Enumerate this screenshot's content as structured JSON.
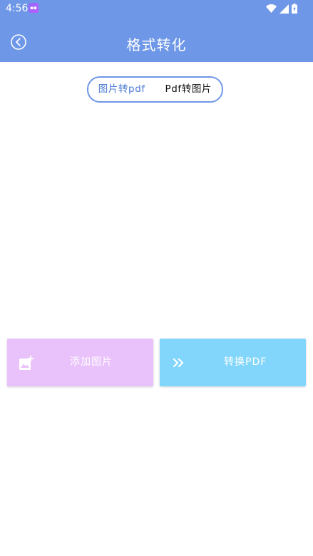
{
  "status_bar": {
    "time": "4:56",
    "notification_icon": "app-notification-icon",
    "icons": [
      "wifi-icon",
      "signal-icon",
      "battery-icon"
    ]
  },
  "app_bar": {
    "title": "格式转化",
    "back_icon": "back-circle-icon"
  },
  "segmented": {
    "options": [
      {
        "label": "图片转pdf",
        "selected": true
      },
      {
        "label": "Pdf转图片",
        "selected": false
      }
    ]
  },
  "actions": {
    "add_images": {
      "label": "添加图片",
      "icon": "add-photo-icon"
    },
    "convert_pdf": {
      "label": "转换PDF",
      "icon": "double-chevron-right-icon"
    }
  },
  "colors": {
    "primary": "#6e97e7",
    "add_button_bg": "#e9c1fb",
    "convert_button_bg": "#82d6fb",
    "active_segment_text": "#4a7ad2"
  }
}
